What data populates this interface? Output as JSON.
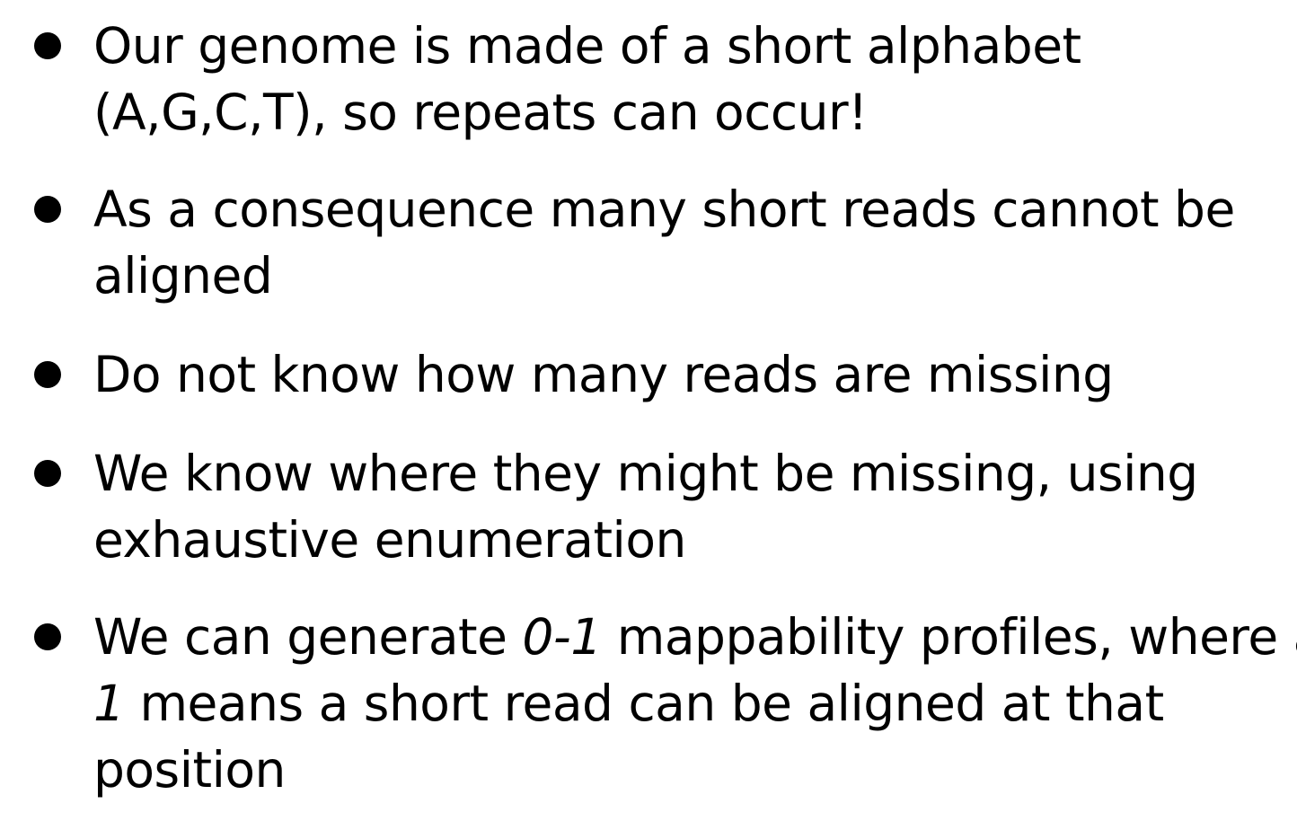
{
  "bullets": [
    {
      "lines": [
        "Our genome is made of a short alphabet",
        "(A,G,C,T), so repeats can occur!"
      ]
    },
    {
      "lines": [
        "As a consequence many short reads cannot be",
        "aligned"
      ]
    },
    {
      "lines": [
        "Do not know how many reads are missing"
      ]
    },
    {
      "lines": [
        "We know where they might be missing, using",
        "exhaustive enumeration"
      ]
    },
    {
      "line1": {
        "pre": "We can generate ",
        "em": "0-1",
        "post": " mappability profiles, where a"
      },
      "line2": {
        "em": "1",
        "post": " means a short read can be aligned at that"
      },
      "line3": "position"
    }
  ]
}
